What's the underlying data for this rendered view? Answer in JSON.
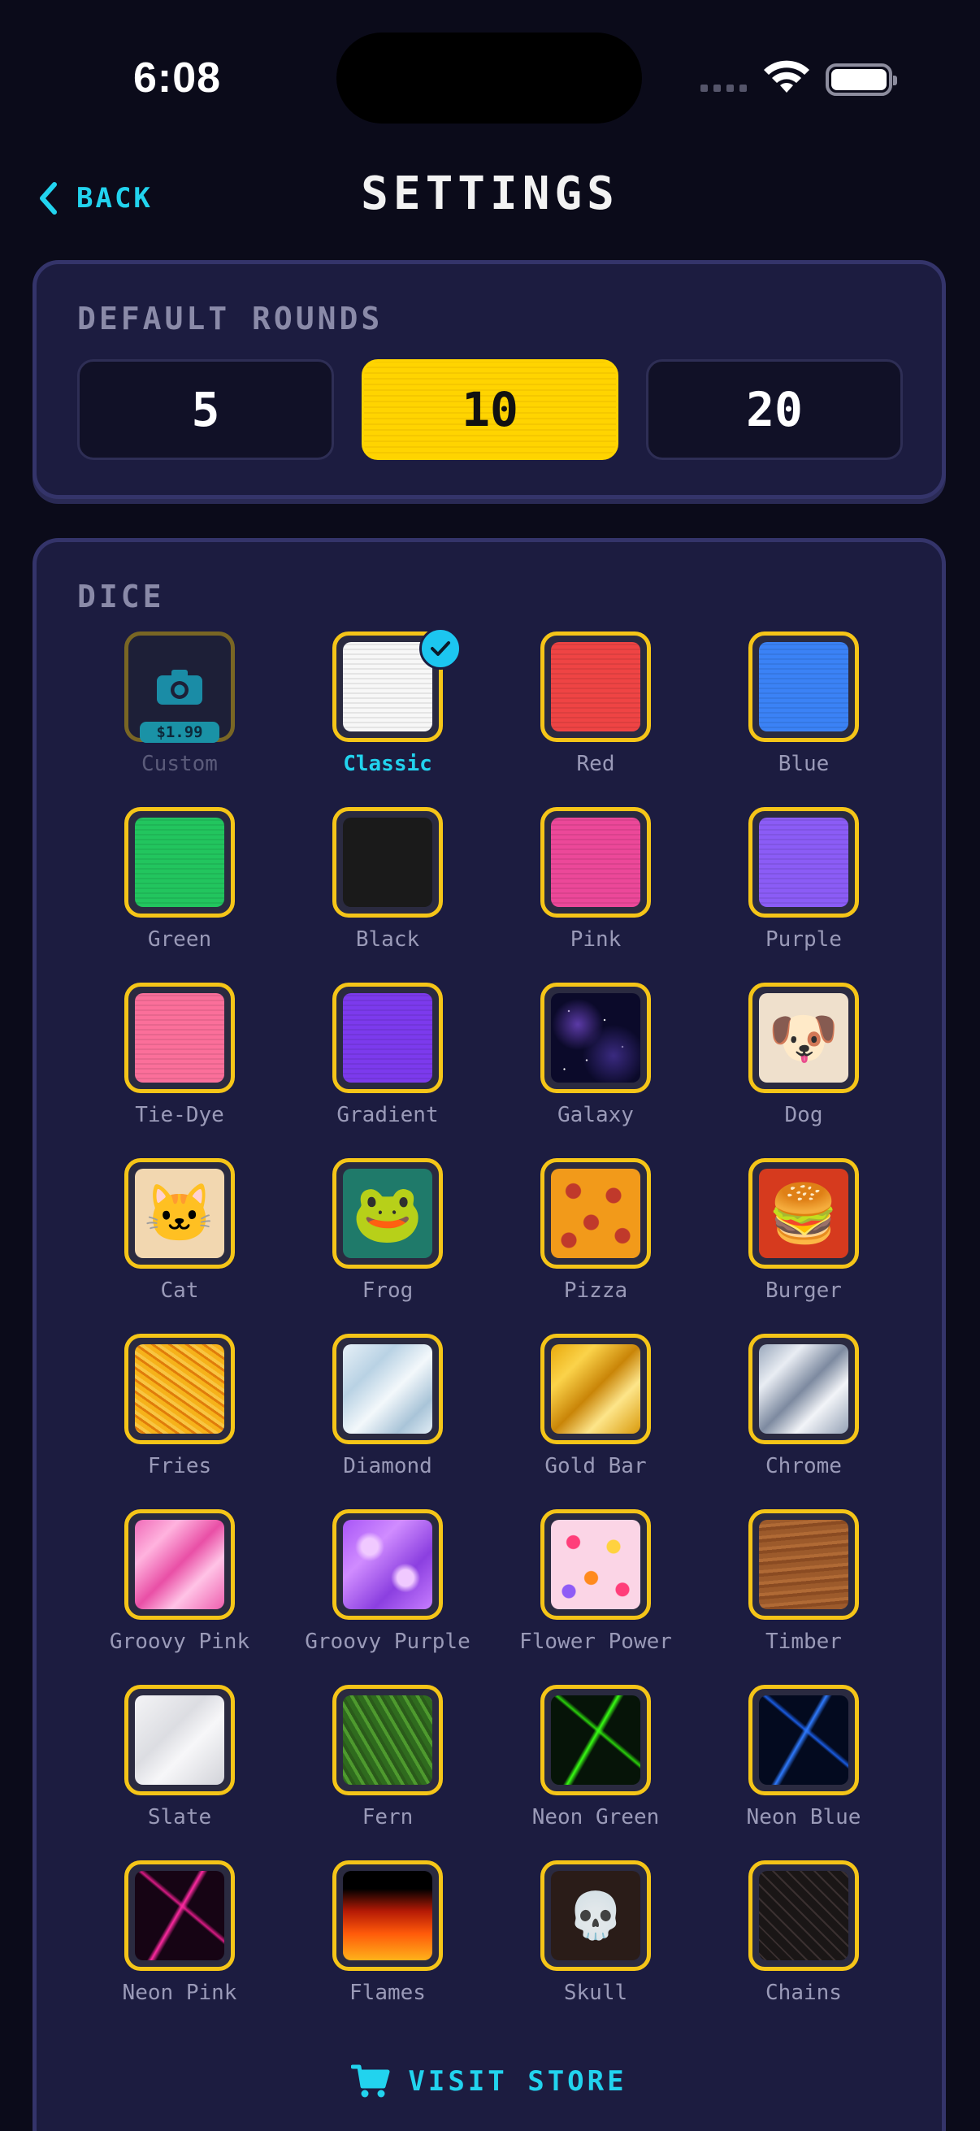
{
  "status_bar": {
    "time": "6:08"
  },
  "header": {
    "back_label": "BACK",
    "title": "SETTINGS"
  },
  "rounds": {
    "label": "DEFAULT ROUNDS",
    "options": [
      "5",
      "10",
      "20"
    ],
    "selected": "10"
  },
  "dice": {
    "label": "DICE",
    "selected": "Classic",
    "custom_price": "$1.99",
    "items": [
      "Custom",
      "Classic",
      "Red",
      "Blue",
      "Green",
      "Black",
      "Pink",
      "Purple",
      "Tie-Dye",
      "Gradient",
      "Galaxy",
      "Dog",
      "Cat",
      "Frog",
      "Pizza",
      "Burger",
      "Fries",
      "Diamond",
      "Gold Bar",
      "Chrome",
      "Groovy Pink",
      "Groovy Purple",
      "Flower Power",
      "Timber",
      "Slate",
      "Fern",
      "Neon Green",
      "Neon Blue",
      "Neon Pink",
      "Flames",
      "Skull",
      "Chains"
    ]
  },
  "store": {
    "label": "VISIT STORE"
  },
  "colors": {
    "accent": "#22d3ee",
    "selected_round": "#ffd400",
    "tile_border": "#f5c518",
    "panel": "#1c1c40",
    "background": "#0b0b1a"
  }
}
